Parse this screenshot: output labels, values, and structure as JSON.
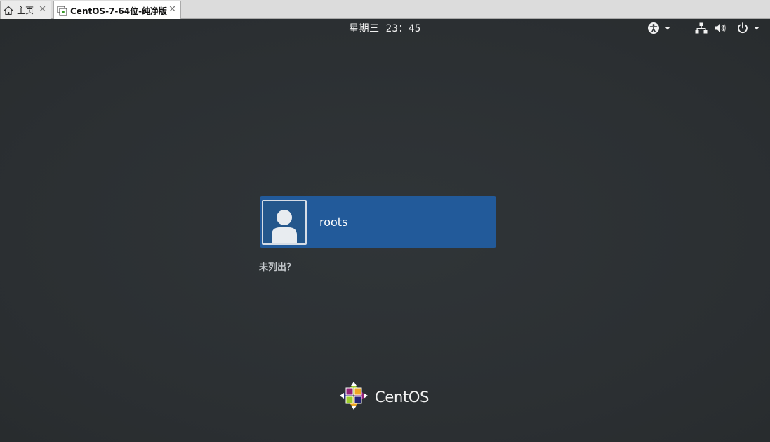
{
  "host_tabs": [
    {
      "label": "主页",
      "icon": "home-icon"
    },
    {
      "label": "CentOS-7-64位-纯净版",
      "icon": "vm-icon"
    }
  ],
  "host_tab_close_glyph": "✕",
  "topbar": {
    "clock": "星期三 23：45",
    "accessibility_icon": "accessibility-icon",
    "network_icon": "network-icon",
    "volume_icon": "volume-icon",
    "power_icon": "power-icon"
  },
  "login": {
    "users": [
      {
        "name": "roots",
        "avatar_icon": "user-avatar-icon"
      }
    ],
    "not_listed_link": "未列出？"
  },
  "branding": {
    "text": "CentOS",
    "logo_icon": "centos-logo-icon"
  },
  "colors": {
    "background": "#2d3134",
    "user_item_selected": "#225a9a",
    "tab_strip": "#dcdcdc"
  }
}
